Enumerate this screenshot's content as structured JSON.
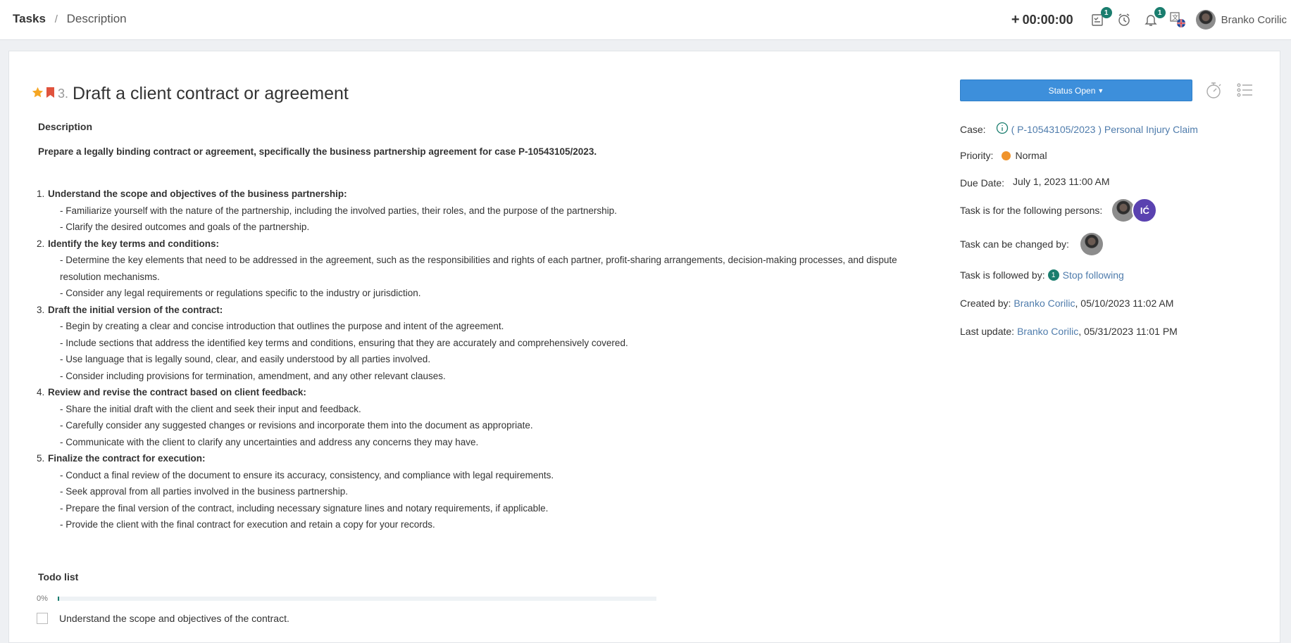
{
  "breadcrumb": {
    "root": "Tasks",
    "separator": "/",
    "current": "Description"
  },
  "topbar": {
    "timer_label": "00:00:00",
    "tasks_badge": "1",
    "notifications_badge": "1",
    "user_name": "Branko Corilic"
  },
  "task": {
    "number": "3.",
    "title": "Draft a client contract or agreement",
    "starred": true,
    "bookmarked": true
  },
  "description": {
    "label": "Description",
    "intro": "Prepare a legally binding contract or agreement, specifically the business partnership agreement for case P-10543105/2023.",
    "steps": [
      {
        "num": "1.",
        "title": "Understand the scope and objectives of the business partnership:",
        "items": [
          "- Familiarize yourself with the nature of the partnership, including the involved parties, their roles, and the purpose of the partnership.",
          "- Clarify the desired outcomes and goals of the partnership."
        ]
      },
      {
        "num": "2.",
        "title": "Identify the key terms and conditions:",
        "items": [
          "- Determine the key elements that need to be addressed in the agreement, such as the responsibilities and rights of each partner, profit-sharing arrangements, decision-making processes, and dispute resolution mechanisms.",
          "- Consider any legal requirements or regulations specific to the industry or jurisdiction."
        ]
      },
      {
        "num": "3.",
        "title": "Draft the initial version of the contract:",
        "items": [
          "- Begin by creating a clear and concise introduction that outlines the purpose and intent of the agreement.",
          "- Include sections that address the identified key terms and conditions, ensuring that they are accurately and comprehensively covered.",
          "- Use language that is legally sound, clear, and easily understood by all parties involved.",
          "- Consider including provisions for termination, amendment, and any other relevant clauses."
        ]
      },
      {
        "num": "4.",
        "title": "Review and revise the contract based on client feedback:",
        "items": [
          "- Share the initial draft with the client and seek their input and feedback.",
          "- Carefully consider any suggested changes or revisions and incorporate them into the document as appropriate.",
          "- Communicate with the client to clarify any uncertainties and address any concerns they may have."
        ]
      },
      {
        "num": "5.",
        "title": "Finalize the contract for execution:",
        "items": [
          "- Conduct a final review of the document to ensure its accuracy, consistency, and compliance with legal requirements.",
          "- Seek approval from all parties involved in the business partnership.",
          "- Prepare the final version of the contract, including necessary signature lines and notary requirements, if applicable.",
          "- Provide the client with the final contract for execution and retain a copy for your records."
        ]
      }
    ]
  },
  "todo": {
    "label": "Todo list",
    "progress_text": "0%",
    "progress_value": 0,
    "items": [
      {
        "text": "Understand the scope and objectives of the contract.",
        "checked": false
      }
    ]
  },
  "details": {
    "status_button": "Status Open",
    "case_label": "Case:",
    "case_value": "( P-10543105/2023 ) Personal Injury Claim",
    "priority_label": "Priority:",
    "priority_value": "Normal",
    "priority_color": "#f0932b",
    "due_label": "Due Date:",
    "due_value": "July 1, 2023 11:00 AM",
    "persons_label": "Task is for the following persons:",
    "persons_initials": "IĆ",
    "changed_by_label": "Task can be changed by:",
    "followed_label": "Task is followed by:",
    "followers_count": "1",
    "stop_following": "Stop following",
    "created_label": "Created by:",
    "created_user": "Branko Corilic",
    "created_date": ", 05/10/2023 11:02 AM",
    "updated_label": "Last update:",
    "updated_user": "Branko Corilic",
    "updated_date": ", 05/31/2023 11:01 PM"
  },
  "colors": {
    "accent_blue": "#3d8fdb",
    "badge_teal": "#1a7d6e",
    "link": "#4f7cac",
    "star": "#f5a623",
    "bookmark": "#e0533d"
  }
}
